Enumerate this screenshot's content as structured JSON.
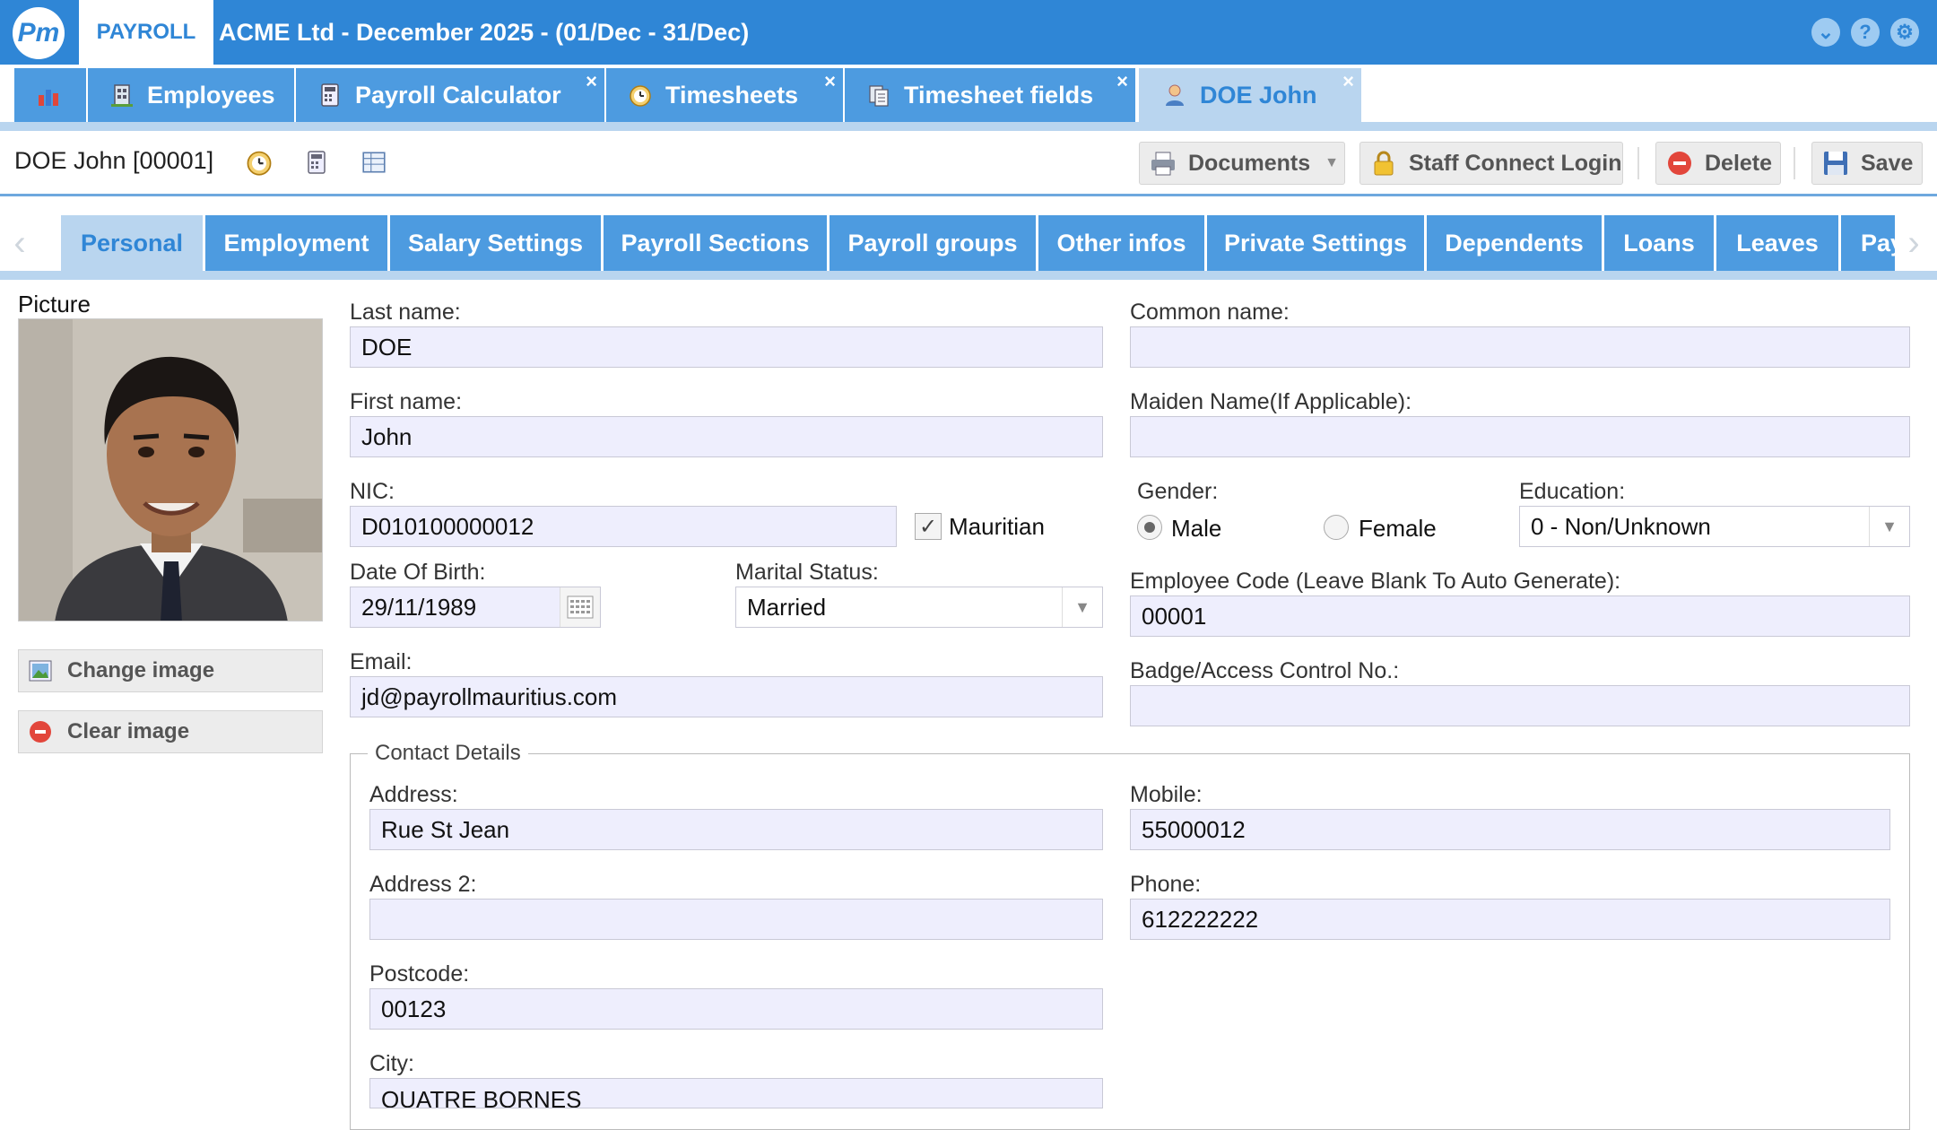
{
  "header": {
    "app_tab": "PAYROLL",
    "company_title": "ACME Ltd - December 2025 - (01/Dec - 31/Dec)",
    "icons": [
      "chevron-down-icon",
      "help-icon",
      "gear-icon"
    ]
  },
  "module_tabs": [
    {
      "label": "",
      "icon": "chart-icon"
    },
    {
      "label": "Employees",
      "icon": "building-icon"
    },
    {
      "label": "Payroll Calculator",
      "icon": "calculator-icon"
    },
    {
      "label": "Timesheets",
      "icon": "clock-icon"
    },
    {
      "label": "Timesheet fields",
      "icon": "pages-icon"
    },
    {
      "label": "DOE John",
      "icon": "user-icon"
    }
  ],
  "close_glyph": "×",
  "record": {
    "title": "DOE John [00001]",
    "buttons": {
      "documents": "Documents",
      "staff_connect": "Staff Connect Login",
      "delete": "Delete",
      "save": "Save"
    }
  },
  "sub_tabs": [
    "Personal",
    "Employment",
    "Salary Settings",
    "Payroll Sections",
    "Payroll groups",
    "Other infos",
    "Private Settings",
    "Dependents",
    "Loans",
    "Leaves",
    "Pay"
  ],
  "picture": {
    "label": "Picture",
    "change_label": "Change image",
    "clear_label": "Clear image"
  },
  "form": {
    "last_name": {
      "label": "Last name:",
      "value": "DOE"
    },
    "common_name": {
      "label": "Common name:",
      "value": ""
    },
    "first_name": {
      "label": "First name:",
      "value": "John"
    },
    "maiden_name": {
      "label": "Maiden Name(If Applicable):",
      "value": ""
    },
    "nic": {
      "label": "NIC:",
      "value": "D010100000012"
    },
    "mauritian": {
      "label": "Mauritian",
      "checked": true
    },
    "gender": {
      "label": "Gender:",
      "options": [
        "Male",
        "Female"
      ],
      "selected": "Male"
    },
    "education": {
      "label": "Education:",
      "value": "0 - Non/Unknown"
    },
    "dob": {
      "label": "Date Of Birth:",
      "value": "29/11/1989"
    },
    "marital": {
      "label": "Marital Status:",
      "value": "Married"
    },
    "employee_code": {
      "label": "Employee Code (Leave Blank To Auto Generate):",
      "value": "00001"
    },
    "email": {
      "label": "Email:",
      "value": "jd@payrollmauritius.com"
    },
    "badge": {
      "label": "Badge/Access Control No.:",
      "value": ""
    }
  },
  "contact": {
    "legend": "Contact Details",
    "address": {
      "label": "Address:",
      "value": "Rue St Jean"
    },
    "mobile": {
      "label": "Mobile:",
      "value": "55000012"
    },
    "address2": {
      "label": "Address 2:",
      "value": ""
    },
    "phone": {
      "label": "Phone:",
      "value": "612222222"
    },
    "postcode": {
      "label": "Postcode:",
      "value": "00123"
    },
    "city": {
      "label": "City:",
      "value": "QUATRE BORNES"
    }
  },
  "colors": {
    "accent": "#2f86d6",
    "tab": "#4d9be0",
    "tab_active": "#b9d5ef",
    "input_bg": "#eeeefd"
  }
}
